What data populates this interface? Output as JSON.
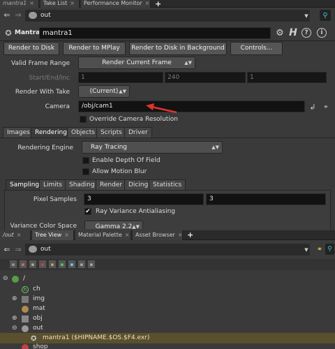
{
  "top_tabs": [
    {
      "label": "mantra1",
      "active": false
    },
    {
      "label": "Take List",
      "active": false
    },
    {
      "label": "Performance Monitor",
      "active": false
    }
  ],
  "top_path": {
    "value": "out"
  },
  "node": {
    "type": "Mantra",
    "name": "mantra1"
  },
  "render_buttons": [
    "Render to Disk",
    "Render to MPlay",
    "Render to Disk in Background",
    "Controls..."
  ],
  "params": {
    "valid_frame_range_label": "Valid Frame Range",
    "valid_frame_range_value": "Render Current Frame",
    "start_end_inc_label": "Start/End/Inc",
    "start": "1",
    "end": "240",
    "inc": "1",
    "render_with_take_label": "Render With Take",
    "render_with_take_value": "(Current)",
    "camera_label": "Camera",
    "camera_value": "/obj/cam1",
    "override_res_label": "Override Camera Resolution"
  },
  "param_tabs": [
    "Images",
    "Rendering",
    "Objects",
    "Scripts",
    "Driver"
  ],
  "rendering": {
    "engine_label": "Rendering Engine",
    "engine_value": "Ray Tracing",
    "dof_label": "Enable Depth Of Field",
    "motion_blur_label": "Allow Motion Blur"
  },
  "sub_tabs": [
    "Sampling",
    "Limits",
    "Shading",
    "Render",
    "Dicing",
    "Statistics"
  ],
  "sampling": {
    "pixel_samples_label": "Pixel Samples",
    "pixel_samples_x": "3",
    "pixel_samples_y": "3",
    "ray_variance_label": "Ray Variance Antialiasing",
    "variance_color_space_label": "Variance Color Space",
    "variance_color_space_value": "Gamma 2.2"
  },
  "bottom_tabs": [
    {
      "label": "/out",
      "active": false
    },
    {
      "label": "Tree View",
      "active": true
    },
    {
      "label": "Material Palette",
      "active": false
    },
    {
      "label": "Asset Browser",
      "active": false
    }
  ],
  "bottom_path": {
    "value": "out"
  },
  "tree": [
    {
      "label": "/",
      "icon": "globe-icon"
    },
    {
      "label": "ch",
      "icon": "channel-icon"
    },
    {
      "label": "img",
      "icon": "image-icon"
    },
    {
      "label": "mat",
      "icon": "material-icon"
    },
    {
      "label": "obj",
      "icon": "object-icon"
    },
    {
      "label": "out",
      "icon": "output-icon"
    },
    {
      "label": "mantra1 ($HIPNAME.$OS.$F4.exr)",
      "icon": "mantra-icon"
    },
    {
      "label": "shop",
      "icon": "shop-icon"
    }
  ],
  "colors": {
    "accent_arrow": "#e0332e",
    "selected_row": "#5a5030",
    "panel": "#3a3a3a"
  }
}
